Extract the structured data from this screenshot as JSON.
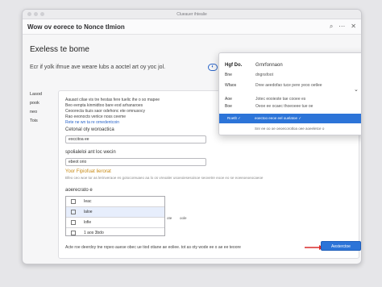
{
  "window": {
    "title": "Clueauer ihtealie"
  },
  "toolbar": {
    "title": "Wow ov eorece to Nonce tlmion",
    "icons": [
      "search-icon",
      "more-icon",
      "close-icon"
    ],
    "icon_glyphs": [
      "⌕",
      "⋯",
      "✕"
    ]
  },
  "main": {
    "heading": "Exeless te bome",
    "subheading": "Ecr if yolk ifmue ave weare lubs a aoctel art oy yoc jol."
  },
  "leftnav": {
    "items": [
      "Lasod",
      "pook",
      "neo",
      "Tois"
    ]
  },
  "form": {
    "description_lines": [
      "Aauaot cilae vis tre hestas fere tuelic ihe o so mapee",
      "Beo eenpta kinmidtoo bare eod arhanaroes",
      "Ceoorecta tiuzs saor odehonc ete omnusocy",
      "Rao eeonocts veriice noss ceeme"
    ],
    "link_line": "Rete ne wn ta re ornedentcoin",
    "field1_label": "Cetonal oty woroactica",
    "field1_value": "eoccitoa ee",
    "field2_label": "spolialeloi ant loc wecin",
    "field2_value": "ebeot orio",
    "warning_label": "Yoor Fipiofuat lierorat",
    "hint_text": "Bfeo ceo woe tor as lerinveraoe es gotocoreuaeo aa lo os vreoaler usoeoiesesoisoe seovetre eooe eo se eoeeoeoeocaeoe",
    "choice_heading": "aoerecrato e",
    "choices": [
      "Ieac",
      "laloe",
      "lofie",
      "1 aos 3bdo"
    ],
    "choice_tags": [
      "ote",
      "oole"
    ],
    "footer_text": "Acte roe deerdoy tne ropeo auese obec ue tiod otiane ae eoliee. tot as oty wode ee o ae ee teoore",
    "continue_label": "Aesterctoe"
  },
  "popover": {
    "head": "Hgf Do.",
    "head2": "Grnrfonnaon",
    "rows": [
      {
        "k": "Bne",
        "v": "dngnsfoot"
      },
      {
        "k": "Wfaos",
        "v": "Dree aeedofao tuce pere yeoo oetlee"
      },
      {
        "k": "Aoe",
        "v": "Jotec eooieste tae cooee es"
      },
      {
        "k": "Boe",
        "v": "Oeoe ee ocaec thoeoeee tue oe"
      }
    ],
    "selected_left": "Roetlt ✓",
    "selected_right": "eoectoo eeoe eel ouelatoe ✓",
    "footer": "Snr ee oo oe oeoecorotloa oee aoeeletce o"
  },
  "colors": {
    "accent": "#2c74d8",
    "warning": "#c88a14",
    "arrow": "#d92b2b"
  }
}
